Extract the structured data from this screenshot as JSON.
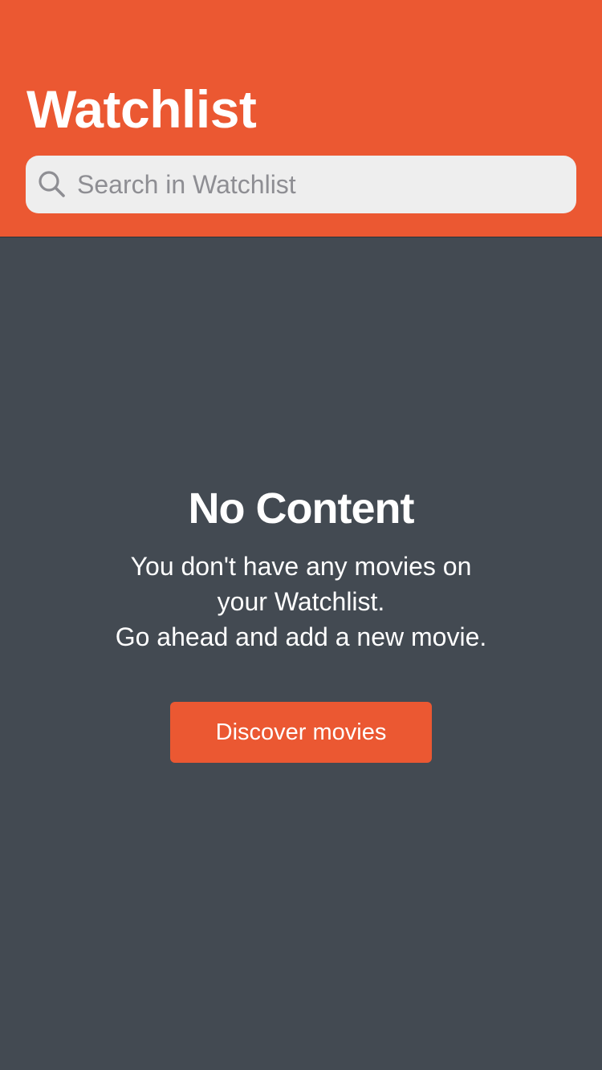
{
  "header": {
    "title": "Watchlist",
    "background_color": "#eb5832"
  },
  "search": {
    "placeholder": "Search in Watchlist",
    "value": "",
    "icon": "search-icon"
  },
  "empty_state": {
    "title": "No Content",
    "message_lines": [
      "You don't have any movies on",
      "your Watchlist.",
      "Go ahead and add a new movie."
    ],
    "button_label": "Discover movies"
  },
  "colors": {
    "accent": "#eb5832",
    "background": "#434a52",
    "search_field": "#eeeeee",
    "placeholder": "#8e8e93",
    "text": "#ffffff"
  }
}
